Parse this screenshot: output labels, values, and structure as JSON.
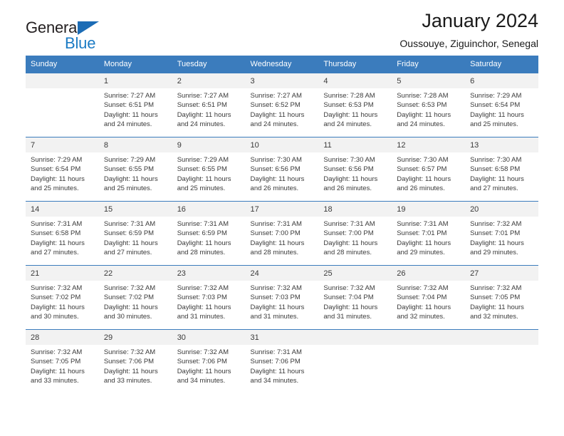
{
  "brand": {
    "name_part1": "General",
    "name_part2": "Blue",
    "triangle_color": "#1c6cb5",
    "blue_color": "#1b7bc4"
  },
  "header": {
    "title": "January 2024",
    "subtitle": "Oussouye, Ziguinchor, Senegal"
  },
  "theme": {
    "header_bg": "#3b7cbd",
    "header_text": "#ffffff",
    "daynum_bg": "#f2f2f2",
    "grid_line": "#3b7cbd"
  },
  "weekdays": [
    "Sunday",
    "Monday",
    "Tuesday",
    "Wednesday",
    "Thursday",
    "Friday",
    "Saturday"
  ],
  "weeks": [
    [
      {
        "day": "",
        "lines": []
      },
      {
        "day": "1",
        "lines": [
          "Sunrise: 7:27 AM",
          "Sunset: 6:51 PM",
          "Daylight: 11 hours",
          "and 24 minutes."
        ]
      },
      {
        "day": "2",
        "lines": [
          "Sunrise: 7:27 AM",
          "Sunset: 6:51 PM",
          "Daylight: 11 hours",
          "and 24 minutes."
        ]
      },
      {
        "day": "3",
        "lines": [
          "Sunrise: 7:27 AM",
          "Sunset: 6:52 PM",
          "Daylight: 11 hours",
          "and 24 minutes."
        ]
      },
      {
        "day": "4",
        "lines": [
          "Sunrise: 7:28 AM",
          "Sunset: 6:53 PM",
          "Daylight: 11 hours",
          "and 24 minutes."
        ]
      },
      {
        "day": "5",
        "lines": [
          "Sunrise: 7:28 AM",
          "Sunset: 6:53 PM",
          "Daylight: 11 hours",
          "and 24 minutes."
        ]
      },
      {
        "day": "6",
        "lines": [
          "Sunrise: 7:29 AM",
          "Sunset: 6:54 PM",
          "Daylight: 11 hours",
          "and 25 minutes."
        ]
      }
    ],
    [
      {
        "day": "7",
        "lines": [
          "Sunrise: 7:29 AM",
          "Sunset: 6:54 PM",
          "Daylight: 11 hours",
          "and 25 minutes."
        ]
      },
      {
        "day": "8",
        "lines": [
          "Sunrise: 7:29 AM",
          "Sunset: 6:55 PM",
          "Daylight: 11 hours",
          "and 25 minutes."
        ]
      },
      {
        "day": "9",
        "lines": [
          "Sunrise: 7:29 AM",
          "Sunset: 6:55 PM",
          "Daylight: 11 hours",
          "and 25 minutes."
        ]
      },
      {
        "day": "10",
        "lines": [
          "Sunrise: 7:30 AM",
          "Sunset: 6:56 PM",
          "Daylight: 11 hours",
          "and 26 minutes."
        ]
      },
      {
        "day": "11",
        "lines": [
          "Sunrise: 7:30 AM",
          "Sunset: 6:56 PM",
          "Daylight: 11 hours",
          "and 26 minutes."
        ]
      },
      {
        "day": "12",
        "lines": [
          "Sunrise: 7:30 AM",
          "Sunset: 6:57 PM",
          "Daylight: 11 hours",
          "and 26 minutes."
        ]
      },
      {
        "day": "13",
        "lines": [
          "Sunrise: 7:30 AM",
          "Sunset: 6:58 PM",
          "Daylight: 11 hours",
          "and 27 minutes."
        ]
      }
    ],
    [
      {
        "day": "14",
        "lines": [
          "Sunrise: 7:31 AM",
          "Sunset: 6:58 PM",
          "Daylight: 11 hours",
          "and 27 minutes."
        ]
      },
      {
        "day": "15",
        "lines": [
          "Sunrise: 7:31 AM",
          "Sunset: 6:59 PM",
          "Daylight: 11 hours",
          "and 27 minutes."
        ]
      },
      {
        "day": "16",
        "lines": [
          "Sunrise: 7:31 AM",
          "Sunset: 6:59 PM",
          "Daylight: 11 hours",
          "and 28 minutes."
        ]
      },
      {
        "day": "17",
        "lines": [
          "Sunrise: 7:31 AM",
          "Sunset: 7:00 PM",
          "Daylight: 11 hours",
          "and 28 minutes."
        ]
      },
      {
        "day": "18",
        "lines": [
          "Sunrise: 7:31 AM",
          "Sunset: 7:00 PM",
          "Daylight: 11 hours",
          "and 28 minutes."
        ]
      },
      {
        "day": "19",
        "lines": [
          "Sunrise: 7:31 AM",
          "Sunset: 7:01 PM",
          "Daylight: 11 hours",
          "and 29 minutes."
        ]
      },
      {
        "day": "20",
        "lines": [
          "Sunrise: 7:32 AM",
          "Sunset: 7:01 PM",
          "Daylight: 11 hours",
          "and 29 minutes."
        ]
      }
    ],
    [
      {
        "day": "21",
        "lines": [
          "Sunrise: 7:32 AM",
          "Sunset: 7:02 PM",
          "Daylight: 11 hours",
          "and 30 minutes."
        ]
      },
      {
        "day": "22",
        "lines": [
          "Sunrise: 7:32 AM",
          "Sunset: 7:02 PM",
          "Daylight: 11 hours",
          "and 30 minutes."
        ]
      },
      {
        "day": "23",
        "lines": [
          "Sunrise: 7:32 AM",
          "Sunset: 7:03 PM",
          "Daylight: 11 hours",
          "and 31 minutes."
        ]
      },
      {
        "day": "24",
        "lines": [
          "Sunrise: 7:32 AM",
          "Sunset: 7:03 PM",
          "Daylight: 11 hours",
          "and 31 minutes."
        ]
      },
      {
        "day": "25",
        "lines": [
          "Sunrise: 7:32 AM",
          "Sunset: 7:04 PM",
          "Daylight: 11 hours",
          "and 31 minutes."
        ]
      },
      {
        "day": "26",
        "lines": [
          "Sunrise: 7:32 AM",
          "Sunset: 7:04 PM",
          "Daylight: 11 hours",
          "and 32 minutes."
        ]
      },
      {
        "day": "27",
        "lines": [
          "Sunrise: 7:32 AM",
          "Sunset: 7:05 PM",
          "Daylight: 11 hours",
          "and 32 minutes."
        ]
      }
    ],
    [
      {
        "day": "28",
        "lines": [
          "Sunrise: 7:32 AM",
          "Sunset: 7:05 PM",
          "Daylight: 11 hours",
          "and 33 minutes."
        ]
      },
      {
        "day": "29",
        "lines": [
          "Sunrise: 7:32 AM",
          "Sunset: 7:06 PM",
          "Daylight: 11 hours",
          "and 33 minutes."
        ]
      },
      {
        "day": "30",
        "lines": [
          "Sunrise: 7:32 AM",
          "Sunset: 7:06 PM",
          "Daylight: 11 hours",
          "and 34 minutes."
        ]
      },
      {
        "day": "31",
        "lines": [
          "Sunrise: 7:31 AM",
          "Sunset: 7:06 PM",
          "Daylight: 11 hours",
          "and 34 minutes."
        ]
      },
      {
        "day": "",
        "lines": []
      },
      {
        "day": "",
        "lines": []
      },
      {
        "day": "",
        "lines": []
      }
    ]
  ]
}
